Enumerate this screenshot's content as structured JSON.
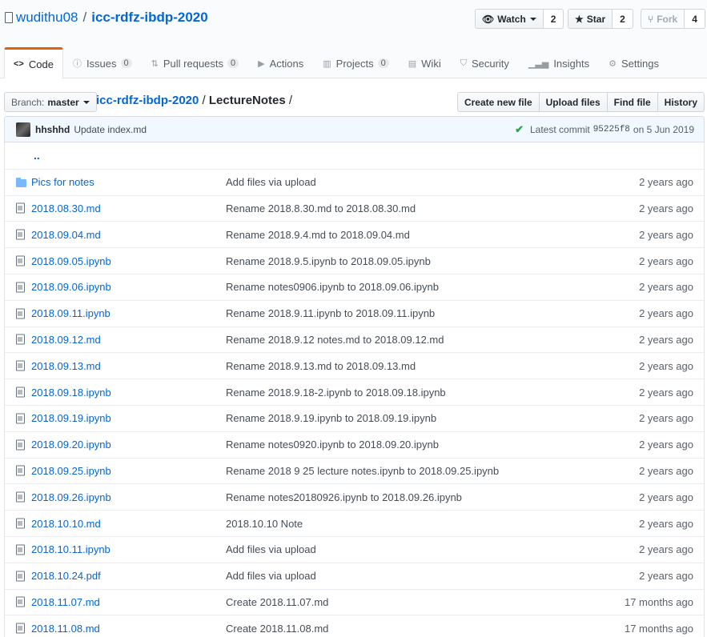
{
  "repo": {
    "owner": "wudithu08",
    "separator": "/",
    "name": "icc-rdfz-ibdp-2020"
  },
  "social": {
    "watch": {
      "label": "Watch",
      "count": "2"
    },
    "star": {
      "label": "Star",
      "count": "2"
    },
    "fork": {
      "label": "Fork",
      "count": "4"
    }
  },
  "tabs": [
    {
      "label": "Code",
      "icon": "code-icon",
      "count": ""
    },
    {
      "label": "Issues",
      "icon": "issue-icon",
      "count": "0"
    },
    {
      "label": "Pull requests",
      "icon": "pull-request-icon",
      "count": "0"
    },
    {
      "label": "Actions",
      "icon": "play-icon",
      "count": ""
    },
    {
      "label": "Projects",
      "icon": "project-icon",
      "count": "0"
    },
    {
      "label": "Wiki",
      "icon": "book-icon",
      "count": ""
    },
    {
      "label": "Security",
      "icon": "shield-icon",
      "count": ""
    },
    {
      "label": "Insights",
      "icon": "graph-icon",
      "count": ""
    },
    {
      "label": "Settings",
      "icon": "gear-icon",
      "count": ""
    }
  ],
  "branch": {
    "label": "Branch:",
    "value": "master"
  },
  "breadcrumb": {
    "repo": "icc-rdfz-ibdp-2020",
    "sep1": "/",
    "folder": "LectureNotes",
    "sep2": "/"
  },
  "actions": {
    "create": "Create new file",
    "upload": "Upload files",
    "find": "Find file",
    "history": "History"
  },
  "commit": {
    "author": "hhshhd",
    "message": "Update index.md",
    "latest_label": "Latest commit",
    "sha": "95225f8",
    "date": "on 5 Jun 2019"
  },
  "parent_link": "..",
  "files": [
    {
      "type": "dir",
      "name": "Pics for notes",
      "message": "Add files via upload",
      "age": "2 years ago"
    },
    {
      "type": "file",
      "name": "2018.08.30.md",
      "message": "Rename 2018.8.30.md to 2018.08.30.md",
      "age": "2 years ago"
    },
    {
      "type": "file",
      "name": "2018.09.04.md",
      "message": "Rename 2018.9.4.md to 2018.09.04.md",
      "age": "2 years ago"
    },
    {
      "type": "file",
      "name": "2018.09.05.ipynb",
      "message": "Rename 2018.9.5.ipynb to 2018.09.05.ipynb",
      "age": "2 years ago"
    },
    {
      "type": "file",
      "name": "2018.09.06.ipynb",
      "message": "Rename notes0906.ipynb to 2018.09.06.ipynb",
      "age": "2 years ago"
    },
    {
      "type": "file",
      "name": "2018.09.11.ipynb",
      "message": "Rename 2018.9.11.ipynb to 2018.09.11.ipynb",
      "age": "2 years ago"
    },
    {
      "type": "file",
      "name": "2018.09.12.md",
      "message": "Rename 2018.9.12 notes.md to 2018.09.12.md",
      "age": "2 years ago"
    },
    {
      "type": "file",
      "name": "2018.09.13.md",
      "message": "Rename 2018.9.13.md to 2018.09.13.md",
      "age": "2 years ago"
    },
    {
      "type": "file",
      "name": "2018.09.18.ipynb",
      "message": "Rename 2018.9.18-2.ipynb to 2018.09.18.ipynb",
      "age": "2 years ago"
    },
    {
      "type": "file",
      "name": "2018.09.19.ipynb",
      "message": "Rename 2018.9.19.ipynb to 2018.09.19.ipynb",
      "age": "2 years ago"
    },
    {
      "type": "file",
      "name": "2018.09.20.ipynb",
      "message": "Rename notes0920.ipynb to 2018.09.20.ipynb",
      "age": "2 years ago"
    },
    {
      "type": "file",
      "name": "2018.09.25.ipynb",
      "message": "Rename 2018 9 25 lecture notes.ipynb to 2018.09.25.ipynb",
      "age": "2 years ago"
    },
    {
      "type": "file",
      "name": "2018.09.26.ipynb",
      "message": "Rename notes20180926.ipynb to 2018.09.26.ipynb",
      "age": "2 years ago"
    },
    {
      "type": "file",
      "name": "2018.10.10.md",
      "message": "2018.10.10 Note",
      "age": "2 years ago"
    },
    {
      "type": "file",
      "name": "2018.10.11.ipynb",
      "message": "Add files via upload",
      "age": "2 years ago"
    },
    {
      "type": "file",
      "name": "2018.10.24.pdf",
      "message": "Add files via upload",
      "age": "2 years ago"
    },
    {
      "type": "file",
      "name": "2018.11.07.md",
      "message": "Create 2018.11.07.md",
      "age": "17 months ago"
    },
    {
      "type": "file",
      "name": "2018.11.08.md",
      "message": "Create 2018.11.08.md",
      "age": "17 months ago"
    }
  ],
  "colors": {
    "link": "#0366d6",
    "tab_accent": "#e36209",
    "success": "#28a745",
    "commit_bg": "#f1f8ff"
  }
}
